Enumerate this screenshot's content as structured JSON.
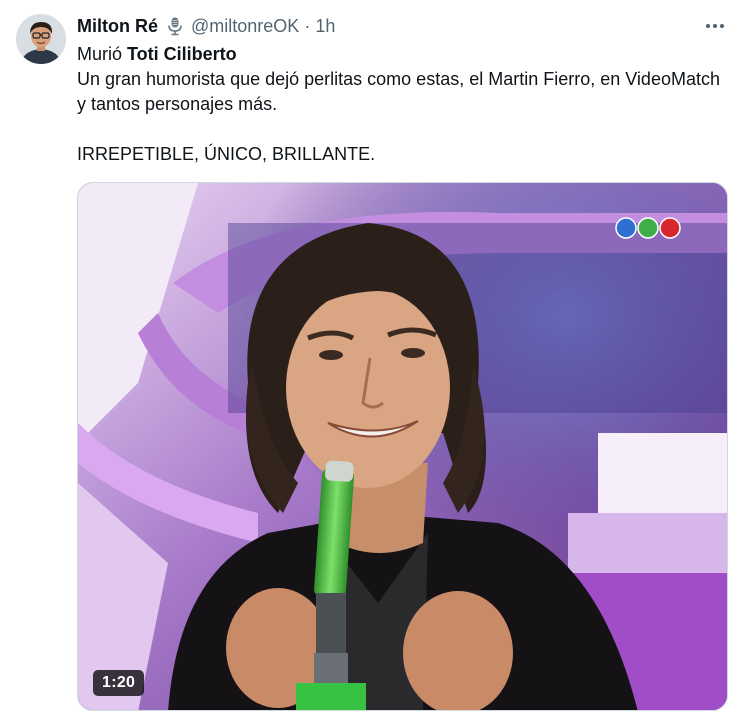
{
  "author": {
    "display_name": "Milton Ré",
    "handle": "@miltonreOK",
    "separator": "·",
    "time": "1h",
    "verified_icon": "microphone-icon"
  },
  "tweet": {
    "line1_prefix": "Murió ",
    "line1_bold": "Toti Ciliberto",
    "line2": "Un gran humorista que dejó perlitas como estas, el Martin Fierro, en VideoMatch y tantos personajes más.",
    "line3": "IRREPETIBLE, ÚNICO, BRILLANTE."
  },
  "media": {
    "type": "video",
    "duration": "1:20",
    "channel_logo": "telefe-logo",
    "logo_colors": [
      "#2f6fd1",
      "#3fae49",
      "#d8262e"
    ]
  },
  "actions": {
    "more_icon": "more-icon"
  }
}
